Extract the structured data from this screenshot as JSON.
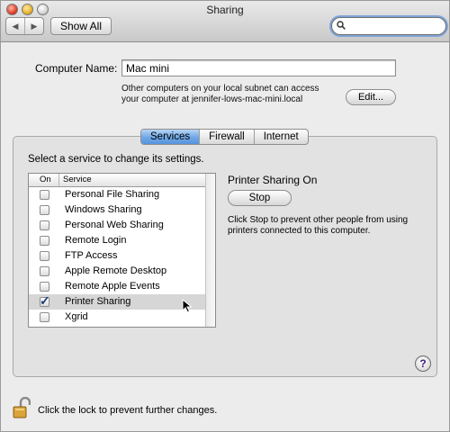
{
  "window": {
    "title": "Sharing",
    "show_all_label": "Show All",
    "nav_back": "◀",
    "nav_forward": "▶",
    "search_value": ""
  },
  "computer_name": {
    "label": "Computer Name:",
    "value": "Mac mini",
    "note": "Other computers on your local subnet can access your computer at jennifer-lows-mac-mini.local",
    "edit_label": "Edit..."
  },
  "tabs": [
    {
      "label": "Services",
      "selected": true
    },
    {
      "label": "Firewall",
      "selected": false
    },
    {
      "label": "Internet",
      "selected": false
    }
  ],
  "services": {
    "prompt": "Select a service to change its settings.",
    "col_on": "On",
    "col_service": "Service",
    "items": [
      {
        "name": "Personal File Sharing",
        "on": false
      },
      {
        "name": "Windows Sharing",
        "on": false
      },
      {
        "name": "Personal Web Sharing",
        "on": false
      },
      {
        "name": "Remote Login",
        "on": false
      },
      {
        "name": "FTP Access",
        "on": false
      },
      {
        "name": "Apple Remote Desktop",
        "on": false
      },
      {
        "name": "Remote Apple Events",
        "on": false
      },
      {
        "name": "Printer Sharing",
        "on": true,
        "selected": true
      },
      {
        "name": "Xgrid",
        "on": false
      }
    ]
  },
  "detail": {
    "status": "Printer Sharing On",
    "button_label": "Stop",
    "description": "Click Stop to prevent other people from using printers connected to this computer."
  },
  "help_label": "?",
  "lock_text": "Click the lock to prevent further changes.",
  "colors": {
    "selected_tab": "#6ea7e6",
    "search_focus": "#7fa4d8"
  },
  "icons": [
    "search-icon",
    "help-icon",
    "lock-icon",
    "mouse-cursor-icon"
  ]
}
